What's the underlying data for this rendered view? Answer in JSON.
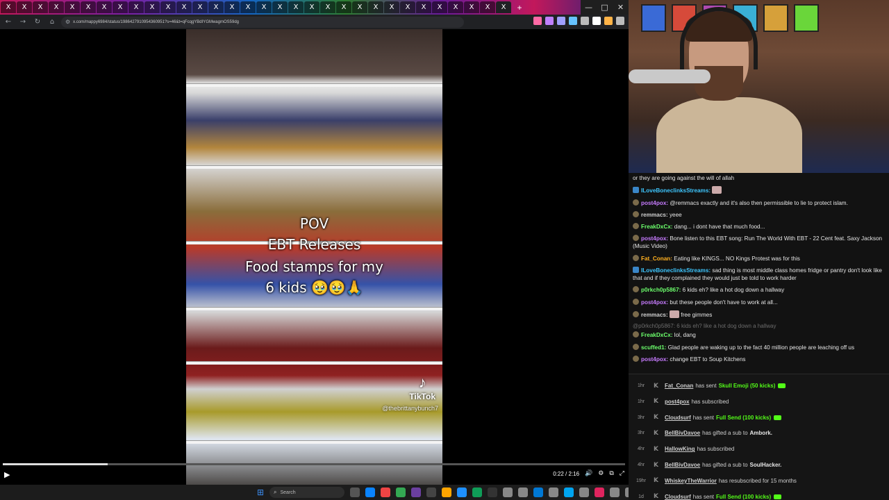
{
  "browser": {
    "tabs": [
      "X",
      "X",
      "X",
      "X",
      "X",
      "X",
      "X",
      "X",
      "X",
      "X",
      "X",
      "X",
      "X",
      "X",
      "X",
      "X",
      "X",
      "X",
      "X",
      "X",
      "X",
      "X",
      "X",
      "X",
      "X",
      "X",
      "X",
      "X",
      "X",
      "X",
      "X",
      "X"
    ],
    "active_tab_index": 31,
    "new_tab_symbol": "+",
    "window_controls": {
      "minimize": "—",
      "maximize": "□",
      "close": "✕"
    },
    "nav": {
      "back": "←",
      "forward": "→",
      "reload": "↻",
      "home": "⌂"
    },
    "url": "x.com/mappy6984/status/1986427910954360951?s=46&t=qFcqgYBdIYGMwagmOS59dg",
    "extension_colors": [
      "#ff6aa6",
      "#c080ff",
      "#a0a0ff",
      "#66c2ff",
      "#bbbbbb",
      "#ffffff",
      "#ffb347",
      "#bbbbbb"
    ]
  },
  "video": {
    "overlay_lines": [
      "POV",
      "EBT Releases",
      "Food stamps for my",
      "6 kids 🥹🥹🙏"
    ],
    "tiktok_label": "TikTok",
    "tiktok_logo": "♪",
    "tiktok_handle": "@thebrittanybunch7",
    "progress_fraction": 0.168,
    "play_icon": "▶",
    "time": "0:22 / 2:16",
    "ctl_icons": {
      "volume": "🔊",
      "settings": "⚙",
      "pip": "⧉",
      "fullscreen": "⤢"
    }
  },
  "taskbar": {
    "start_icon": "⊞",
    "search_icon": "⌕",
    "search_placeholder": "Search",
    "app_colors": [
      "#555",
      "#0a84ff",
      "#e44",
      "#34a853",
      "#6b3fa0",
      "#444",
      "#ffa500",
      "#1e90ff",
      "#0f9d58",
      "#333",
      "#888",
      "#888",
      "#0078d4",
      "#888",
      "#00a4ef",
      "#888",
      "#e0245e",
      "#888",
      "#888",
      "#2db400"
    ]
  },
  "chat": {
    "messages": [
      {
        "type": "text",
        "user": "",
        "text": "or they are going against the will of allah",
        "color": "#e6e6e6",
        "icon": ""
      },
      {
        "type": "msg",
        "user": "ILoveBoneclinksStreams:",
        "text": "",
        "color": "#3ec7ff",
        "icon": "tw",
        "emote": true
      },
      {
        "type": "msg",
        "user": "post4pox:",
        "text": " @remmacs exactly and it's also then permissible to lie to protect islam.",
        "color": "#c77bff",
        "icon": "dot"
      },
      {
        "type": "msg",
        "user": "remmacs:",
        "text": " yeee",
        "color": "#d0d0d0",
        "icon": "dot"
      },
      {
        "type": "msg",
        "user": "FreakDxCx:",
        "text": " dang... i dont have that much food...",
        "color": "#6cff6c",
        "icon": "dot"
      },
      {
        "type": "msg",
        "user": "post4pox:",
        "text": " Bone listen to this EBT song: Run The World With EBT - 22 Cent feat. Saxy Jackson (Music Video)",
        "color": "#c77bff",
        "icon": "dot"
      },
      {
        "type": "msg",
        "user": "Fat_Conan:",
        "text": " Eating like KINGS... NO Kings Protest was for this",
        "color": "#ffb020",
        "icon": "dot"
      },
      {
        "type": "msg",
        "user": "ILoveBoneclinksStreams:",
        "text": " sad thing is most middle class homes fridge or pantry don't look like that and if they complained they would just be told to work harder",
        "color": "#3ec7ff",
        "icon": "tw"
      },
      {
        "type": "msg",
        "user": "p0rkch0p5867:",
        "text": " 6 kids eh? like a hot dog down a hallway",
        "color": "#6cff6c",
        "icon": "dot"
      },
      {
        "type": "msg",
        "user": "post4pox:",
        "text": " but these people don't have to work at all...",
        "color": "#c77bff",
        "icon": "dot"
      },
      {
        "type": "msg",
        "user": "remmacs:",
        "text": " free gimmes",
        "color": "#d0d0d0",
        "icon": "dot",
        "emote": true
      },
      {
        "type": "reply",
        "user": "",
        "text": "@p0rkch0p5867: 6 kids eh? like a hot dog down a hallway",
        "color": "#6c6c6c",
        "icon": ""
      },
      {
        "type": "msg",
        "user": "FreakDxCx:",
        "text": " lol, dang",
        "color": "#6cff6c",
        "icon": "dot"
      },
      {
        "type": "msg",
        "user": "scuffed1:",
        "text": " Glad people are waking up to the fact 40 million people are leaching off us",
        "color": "#6cff6c",
        "icon": "dot"
      },
      {
        "type": "msg",
        "user": "post4pox:",
        "text": " change EBT to Soup Kitchens",
        "color": "#c77bff",
        "icon": "dot"
      }
    ]
  },
  "alerts": {
    "kick_glyph": "K",
    "items": [
      {
        "age": "1hr",
        "name": "Fat_Conan",
        "pre": "has sent",
        "hl": "Skull Emoji (50 kicks)",
        "target": "",
        "post": "",
        "kick": true
      },
      {
        "age": "1hr",
        "name": "post4pox",
        "pre": "has subscribed",
        "hl": "",
        "target": "",
        "post": "",
        "kick": false
      },
      {
        "age": "3hr",
        "name": "Cloudsurf",
        "pre": "has sent",
        "hl": "Full Send (100 kicks)",
        "target": "",
        "post": "",
        "kick": true
      },
      {
        "age": "3hr",
        "name": "BellBivDavoe",
        "pre": "has gifted a sub to",
        "hl": "",
        "target": "Ambork.",
        "post": "",
        "kick": false
      },
      {
        "age": "4hr",
        "name": "HallowKing",
        "pre": "has subscribed",
        "hl": "",
        "target": "",
        "post": "",
        "kick": false
      },
      {
        "age": "4hr",
        "name": "BellBivDavoe",
        "pre": "has gifted a sub to",
        "hl": "",
        "target": "SoulHacker.",
        "post": "",
        "kick": false
      },
      {
        "age": "19hr",
        "name": "WhiskeyTheWarrior",
        "pre": "has resubscribed for 15 months",
        "hl": "",
        "target": "",
        "post": "",
        "kick": false
      },
      {
        "age": "1d",
        "name": "Cloudsurf",
        "pre": "has sent",
        "hl": "Full Send (100 kicks)",
        "target": "",
        "post": "",
        "kick": true
      }
    ]
  }
}
